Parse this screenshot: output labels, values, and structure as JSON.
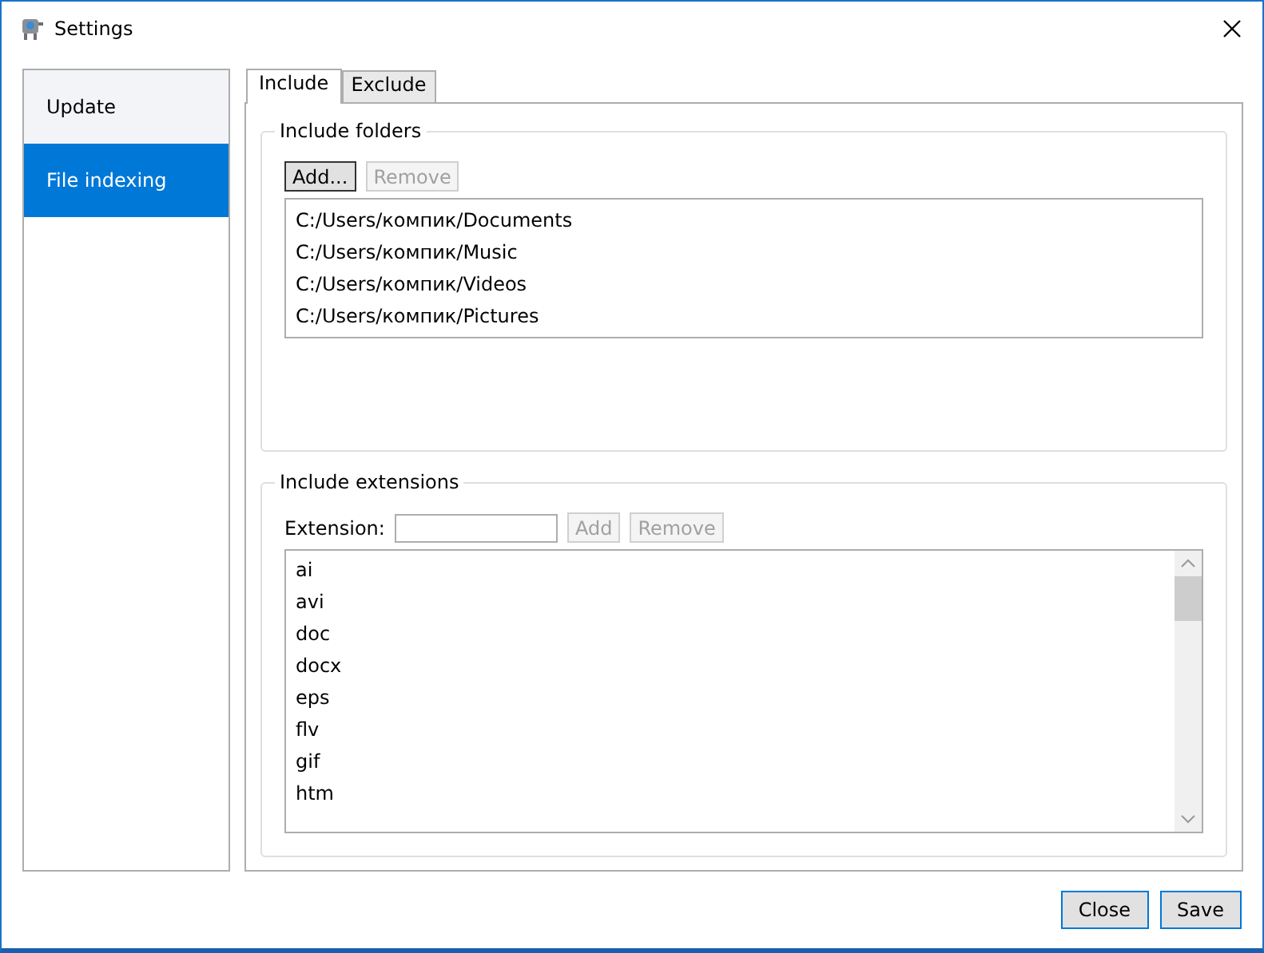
{
  "window": {
    "title": "Settings"
  },
  "sidebar": {
    "items": [
      {
        "label": "Update",
        "selected": false
      },
      {
        "label": "File indexing",
        "selected": true
      }
    ]
  },
  "tabs": [
    {
      "label": "Include",
      "selected": true
    },
    {
      "label": "Exclude",
      "selected": false
    }
  ],
  "folders": {
    "title": "Include folders",
    "buttons": [
      {
        "label": "Add...",
        "disabled": false
      },
      {
        "label": "Remove",
        "disabled": true
      }
    ],
    "items": [
      "C:/Users/компик/Documents",
      "C:/Users/компик/Music",
      "C:/Users/компик/Videos",
      "C:/Users/компик/Pictures"
    ]
  },
  "extensions": {
    "title": "Include extensions",
    "field_label": "Extension:",
    "buttons": [
      {
        "label": "Add",
        "disabled": true
      },
      {
        "label": "Remove",
        "disabled": true
      }
    ],
    "items": [
      "ai",
      "avi",
      "doc",
      "docx",
      "eps",
      "flv",
      "gif",
      "htm"
    ]
  },
  "buttons": [
    "Close",
    "Save"
  ]
}
